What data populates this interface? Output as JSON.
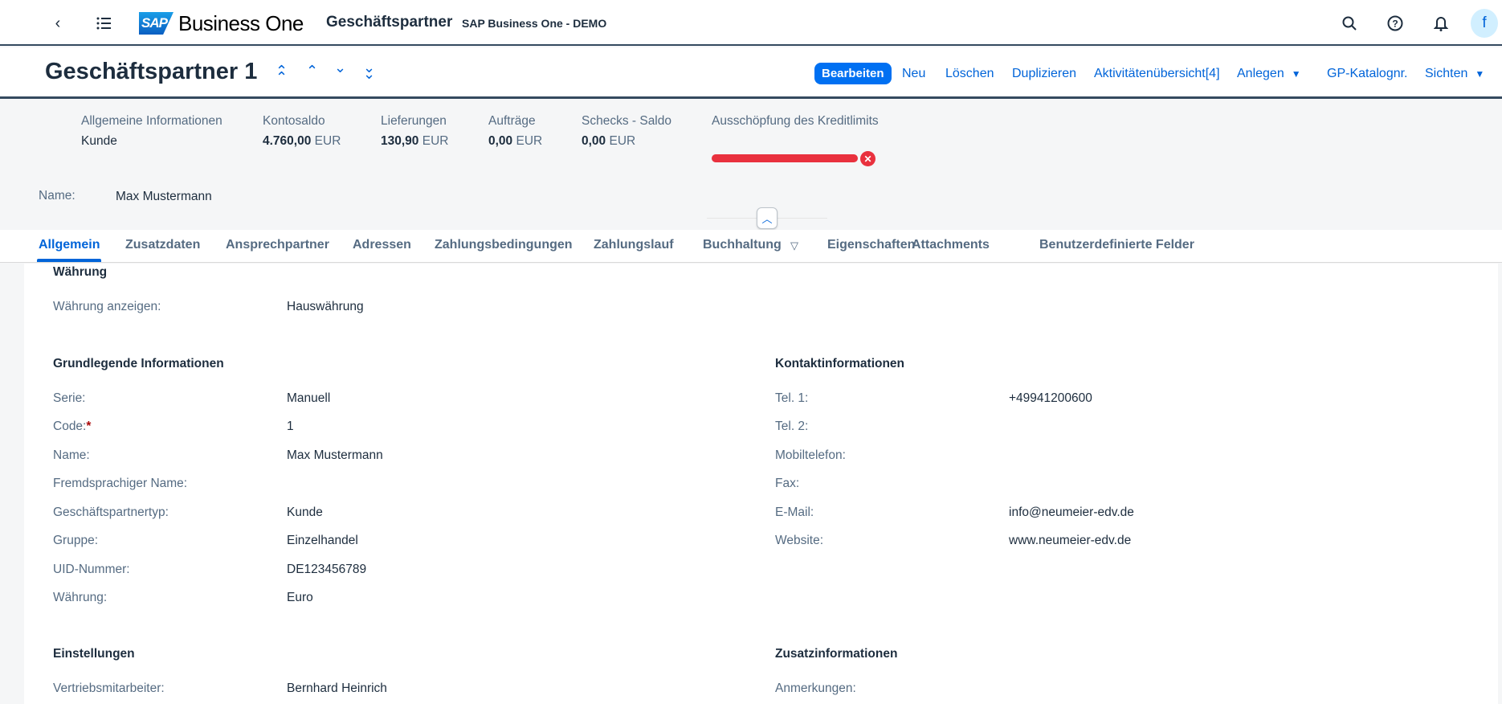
{
  "shell": {
    "logo_sap": "SAP",
    "logo_product": "Business One",
    "app_title": "Geschäftspartner",
    "system": "SAP Business One - DEMO",
    "avatar": "f"
  },
  "object": {
    "title": "Geschäftspartner 1",
    "actions": {
      "edit": "Bearbeiten",
      "new": "Neu",
      "delete": "Löschen",
      "duplicate": "Duplizieren",
      "activities": "Aktivitätenübersicht[4]",
      "create": "Anlegen",
      "catalog": "GP-Katalognr.",
      "views": "Sichten"
    }
  },
  "kpis": [
    {
      "label": "Allgemeine Informationen",
      "value": "Kunde",
      "unit": ""
    },
    {
      "label": "Kontosaldo",
      "value": "4.760,00",
      "unit": "EUR"
    },
    {
      "label": "Lieferungen",
      "value": "130,90",
      "unit": "EUR"
    },
    {
      "label": "Aufträge",
      "value": "0,00",
      "unit": "EUR"
    },
    {
      "label": "Schecks - Saldo",
      "value": "0,00",
      "unit": "EUR"
    },
    {
      "label": "Ausschöpfung des Kreditlimits",
      "progress_percent": 100,
      "status_color": "#e9313e"
    }
  ],
  "header_name": {
    "label": "Name:",
    "value": "Max Mustermann"
  },
  "tabs": [
    "Allgemein",
    "Zusatzdaten",
    "Ansprechpartner",
    "Adressen",
    "Zahlungsbedingungen",
    "Zahlungslauf",
    "Buchhaltung",
    "Eigenschaften",
    "Attachments",
    "Benutzerdefinierte Felder"
  ],
  "currency": {
    "title": "Währung",
    "label": "Währung anzeigen:",
    "value": "Hauswährung"
  },
  "basic": {
    "title": "Grundlegende Informationen",
    "fields": [
      {
        "label": "Serie:",
        "value": "Manuell"
      },
      {
        "label": "Code:",
        "value": "1",
        "required": "*"
      },
      {
        "label": "Name:",
        "value": "Max Mustermann"
      },
      {
        "label": "Fremdsprachiger Name:",
        "value": ""
      },
      {
        "label": "Geschäftspartnertyp:",
        "value": "Kunde"
      },
      {
        "label": "Gruppe:",
        "value": "Einzelhandel"
      },
      {
        "label": "UID-Nummer:",
        "value": "DE123456789"
      },
      {
        "label": "Währung:",
        "value": "Euro"
      }
    ]
  },
  "contact": {
    "title": "Kontaktinformationen",
    "fields": [
      {
        "label": "Tel. 1:",
        "value": "+49941200600"
      },
      {
        "label": "Tel. 2:",
        "value": ""
      },
      {
        "label": "Mobiltelefon:",
        "value": ""
      },
      {
        "label": "Fax:",
        "value": ""
      },
      {
        "label": "E-Mail:",
        "value": "info@neumeier-edv.de"
      },
      {
        "label": "Website:",
        "value": "www.neumeier-edv.de"
      }
    ]
  },
  "settings": {
    "title": "Einstellungen",
    "fields": [
      {
        "label": "Vertriebsmitarbeiter:",
        "value": "Bernhard Heinrich"
      }
    ]
  },
  "extra": {
    "title": "Zusatzinformationen",
    "fields": [
      {
        "label": "Anmerkungen:",
        "value": ""
      }
    ]
  }
}
